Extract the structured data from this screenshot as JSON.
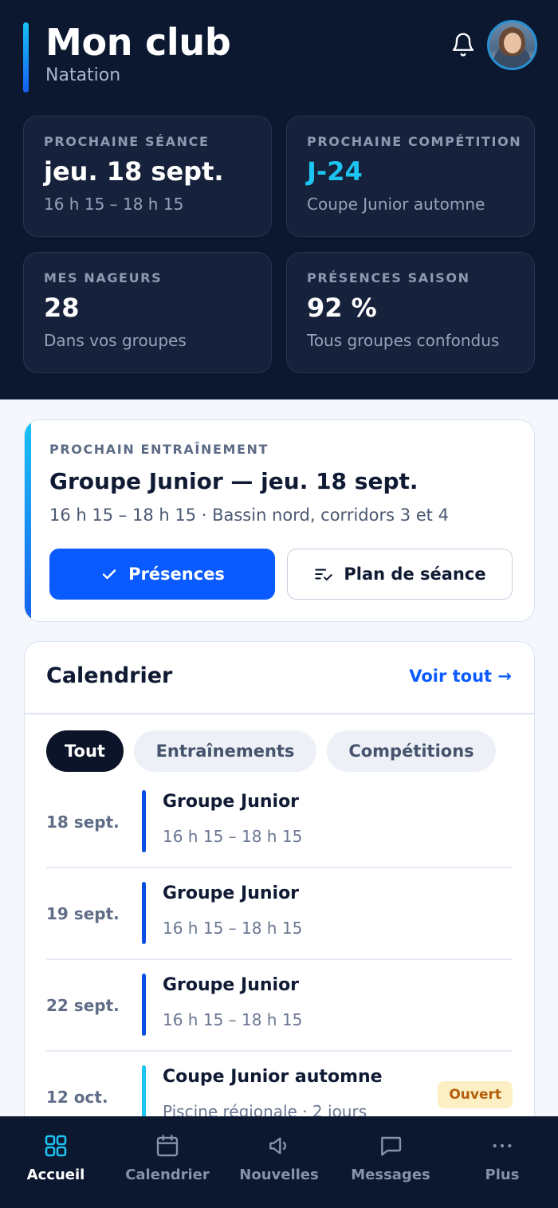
{
  "header": {
    "title": "Mon club",
    "subtitle": "Natation"
  },
  "stats": [
    {
      "label": "PROCHAINE SÉANCE",
      "value": "jeu. 18 sept.",
      "sub": "16 h 15 – 18 h 15"
    },
    {
      "label": "PROCHAINE COMPÉTITION",
      "value": "J-24",
      "sub": "Coupe Junior automne"
    },
    {
      "label": "MES NAGEURS",
      "value": "28",
      "sub": "Dans vos groupes"
    },
    {
      "label": "PRÉSENCES SAISON",
      "value": "92 %",
      "sub": "Tous groupes confondus"
    }
  ],
  "next_training": {
    "label": "PROCHAIN ENTRAÎNEMENT",
    "title": "Groupe Junior — jeu. 18 sept.",
    "meta": "16 h 15 – 18 h 15 · Bassin nord, corridors 3 et 4",
    "primary_button": "Présences",
    "secondary_button": "Plan de séance"
  },
  "calendar": {
    "title": "Calendrier",
    "see_all": "Voir tout →",
    "filters": [
      "Tout",
      "Entraînements",
      "Compétitions"
    ],
    "events": [
      {
        "date": "18 sept.",
        "name": "Groupe Junior",
        "time": "16 h 15 – 18 h 15"
      },
      {
        "date": "19 sept.",
        "name": "Groupe Junior",
        "time": "16 h 15 – 18 h 15"
      },
      {
        "date": "22 sept.",
        "name": "Groupe Junior",
        "time": "16 h 15 – 18 h 15"
      },
      {
        "date": "12 oct.",
        "name": "Coupe Junior automne",
        "time": "Piscine régionale · 2 jours",
        "badge": "Ouvert"
      }
    ]
  },
  "nav": [
    {
      "label": "Accueil",
      "icon": "grid-icon"
    },
    {
      "label": "Calendrier",
      "icon": "calendar-icon"
    },
    {
      "label": "Nouvelles",
      "icon": "megaphone-icon"
    },
    {
      "label": "Messages",
      "icon": "message-icon"
    },
    {
      "label": "Plus",
      "icon": "more-icon"
    }
  ],
  "colors": {
    "header_bg": "#0c1730",
    "accent_blue": "#0a5bff",
    "accent_cyan": "#1cc4f2",
    "badge_bg": "#fdefc4",
    "badge_text": "#b45d0a"
  }
}
